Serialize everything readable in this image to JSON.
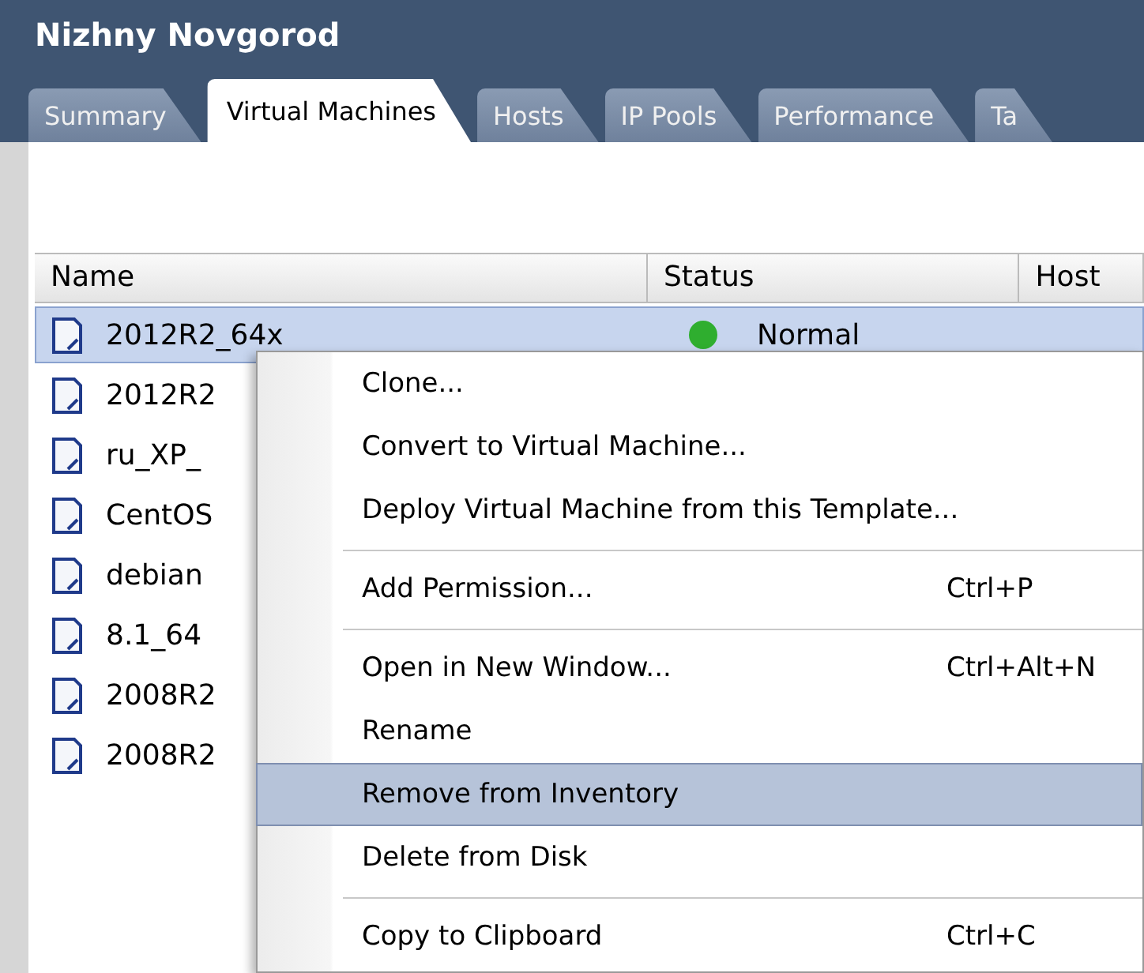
{
  "window": {
    "title": "Nizhny Novgorod"
  },
  "tabs": [
    {
      "label": "Summary",
      "selected": false
    },
    {
      "label": "Virtual Machines",
      "selected": true
    },
    {
      "label": "Hosts",
      "selected": false
    },
    {
      "label": "IP Pools",
      "selected": false
    },
    {
      "label": "Performance",
      "selected": false
    },
    {
      "label": "Ta",
      "selected": false
    }
  ],
  "table": {
    "columns": [
      "Name",
      "Status",
      "Host"
    ],
    "rows": [
      {
        "name": "2012R2_64x",
        "status": "Normal",
        "selected": true
      },
      {
        "name": "2012R2",
        "selected": false
      },
      {
        "name": "ru_XP_",
        "selected": false
      },
      {
        "name": "CentOS",
        "selected": false
      },
      {
        "name": "debian",
        "selected": false
      },
      {
        "name": "8.1_64",
        "selected": false
      },
      {
        "name": "2008R2",
        "selected": false
      },
      {
        "name": "2008R2",
        "selected": false
      }
    ]
  },
  "context_menu": {
    "items": [
      {
        "kind": "item",
        "label": "Clone...",
        "selected": false
      },
      {
        "kind": "item",
        "label": "Convert to Virtual Machine...",
        "selected": false
      },
      {
        "kind": "item",
        "label": "Deploy Virtual Machine from this Template...",
        "selected": false
      },
      {
        "kind": "separator"
      },
      {
        "kind": "item",
        "label": "Add Permission...",
        "shortcut": "Ctrl+P",
        "selected": false
      },
      {
        "kind": "separator"
      },
      {
        "kind": "item",
        "label": "Open in New Window...",
        "shortcut": "Ctrl+Alt+N",
        "selected": false
      },
      {
        "kind": "item",
        "label": "Rename",
        "selected": false
      },
      {
        "kind": "item",
        "label": "Remove from Inventory",
        "selected": true
      },
      {
        "kind": "item",
        "label": "Delete from Disk",
        "selected": false
      },
      {
        "kind": "separator"
      },
      {
        "kind": "item",
        "label": "Copy to Clipboard",
        "shortcut": "Ctrl+C",
        "selected": false
      }
    ]
  }
}
